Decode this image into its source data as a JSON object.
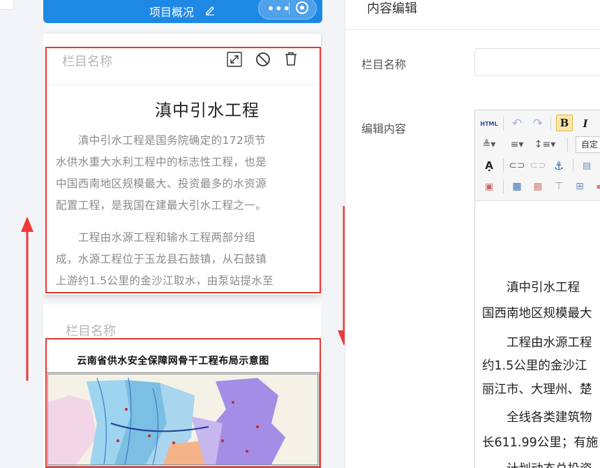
{
  "phone": {
    "title": "项目概况",
    "icons": {
      "title": "pencil-icon",
      "more": "more-dots-icon",
      "target": "target-icon"
    }
  },
  "card1": {
    "label": "栏目名称",
    "actions": [
      "resize-icon",
      "ban-icon",
      "trash-icon"
    ],
    "article": {
      "title": "滇中引水工程",
      "p1": [
        "　　滇中引水工程是国务院确定的172项节",
        "水供水重大水利工程中的标志性工程，也是",
        "中国西南地区规模最大、投资最多的水资源",
        "配置工程，是我国在建最大引水工程之一。"
      ],
      "p2": [
        "　　工程由水源工程和输水工程两部分组",
        "成，水源工程位于玉龙县石鼓镇，从石鼓镇",
        "上游约1.5公里的金沙江取水，由泵站提水至"
      ]
    }
  },
  "card2": {
    "label": "栏目名称",
    "map_title": "云南省供水安全保障网骨干工程布局示意图"
  },
  "editor": {
    "heading": "内容编辑",
    "name_label": "栏目名称",
    "name_value": "",
    "content_label": "编辑内容",
    "toolbar": {
      "html": "HTML",
      "bold": "B",
      "italic": "I",
      "font_select": "自定"
    },
    "body_lines": [
      "　　滇中引水工程",
      "国西南地区规模最大",
      "　　工程由水源工程",
      "约1.5公里的金沙江",
      "丽江市、大理州、楚",
      "　　全线各类建筑物",
      "长611.99公里；有施",
      "　　计划动态总投资"
    ]
  },
  "colors": {
    "accent": "#1e88e5",
    "highlight_border": "#e53935",
    "arrow": "#f03a3a"
  }
}
